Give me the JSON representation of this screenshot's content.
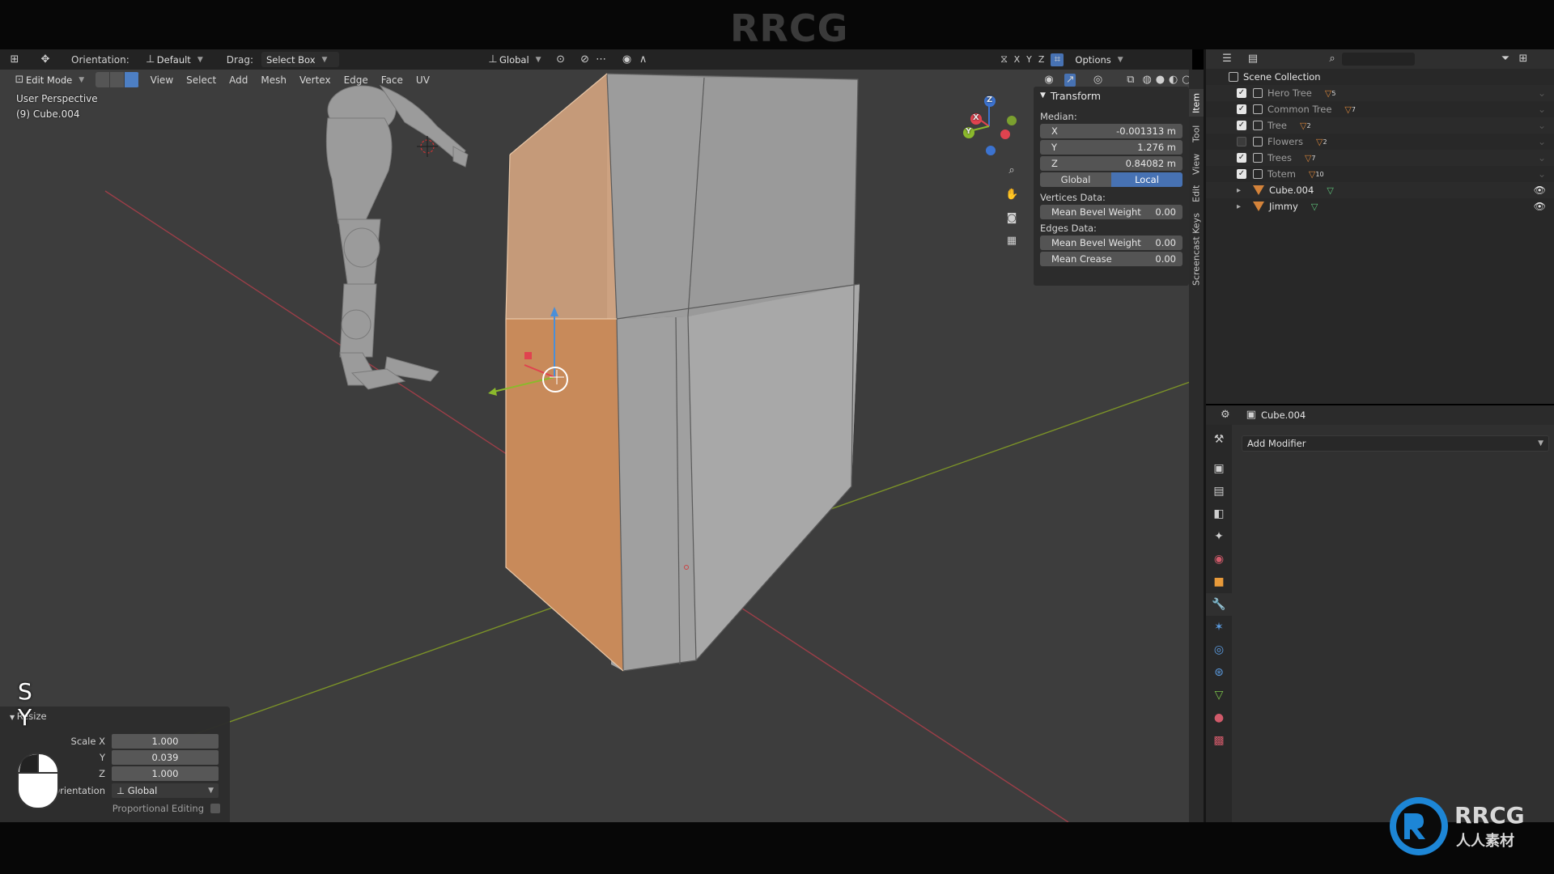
{
  "watermark": {
    "top": "RRCG",
    "logo_main": "RRCG",
    "logo_sub": "人人素材"
  },
  "header": {
    "orientation_label": "Orientation:",
    "orientation_value": "Default",
    "drag_label": "Drag:",
    "drag_value": "Select Box",
    "transform_orientation": "Global",
    "axes": [
      "X",
      "Y",
      "Z"
    ],
    "options_label": "Options"
  },
  "editbar": {
    "mode": "Edit Mode",
    "menus": [
      "View",
      "Select",
      "Add",
      "Mesh",
      "Vertex",
      "Edge",
      "Face",
      "UV"
    ]
  },
  "viewport": {
    "view_name": "User Perspective",
    "object_info": "(9) Cube.004",
    "gizmo_axes": {
      "x": "X",
      "y": "Y",
      "z": "Z"
    }
  },
  "npanel": {
    "title": "Transform",
    "median_label": "Median:",
    "median": [
      {
        "axis": "X",
        "value": "-0.001313 m"
      },
      {
        "axis": "Y",
        "value": "1.276 m"
      },
      {
        "axis": "Z",
        "value": "0.84082 m"
      }
    ],
    "space_options": [
      "Global",
      "Local"
    ],
    "space_active": "Local",
    "vertices_label": "Vertices Data:",
    "vertices_bevel": {
      "label": "Mean Bevel Weight",
      "value": "0.00"
    },
    "edges_label": "Edges Data:",
    "edges_bevel": {
      "label": "Mean Bevel Weight",
      "value": "0.00"
    },
    "edges_crease": {
      "label": "Mean Crease",
      "value": "0.00"
    },
    "tabs": [
      "Item",
      "Tool",
      "View",
      "Edit",
      "Screencast Keys"
    ],
    "active_tab": "Item"
  },
  "outliner": {
    "root": "Scene Collection",
    "items": [
      {
        "name": "Hero Tree",
        "checked": true,
        "kind": "collection",
        "badge": "5",
        "visible": false
      },
      {
        "name": "Common Tree",
        "checked": true,
        "kind": "collection",
        "badge": "7",
        "visible": false
      },
      {
        "name": "Tree",
        "checked": true,
        "kind": "collection",
        "badge": "2",
        "visible": false
      },
      {
        "name": "Flowers",
        "checked": false,
        "kind": "collection",
        "badge": "2",
        "visible": false
      },
      {
        "name": "Trees",
        "checked": true,
        "kind": "collection",
        "badge": "7",
        "visible": false
      },
      {
        "name": "Totem",
        "checked": true,
        "kind": "collection",
        "badge": "10",
        "visible": false
      },
      {
        "name": "Cube.004",
        "checked": null,
        "kind": "object",
        "badge": "",
        "visible": true
      },
      {
        "name": "Jimmy",
        "checked": null,
        "kind": "object",
        "badge": "",
        "visible": true
      }
    ]
  },
  "properties": {
    "object_name": "Cube.004",
    "add_modifier": "Add Modifier"
  },
  "last_operator": {
    "title": "Resize",
    "rows": [
      {
        "label": "Scale X",
        "value": "1.000"
      },
      {
        "label": "Y",
        "value": "0.039"
      },
      {
        "label": "Z",
        "value": "1.000"
      }
    ],
    "orientation_label": "Orientation",
    "orientation_value": "Global",
    "proportional_label": "Proportional Editing"
  },
  "keycast": {
    "first": "S",
    "second": "Y"
  },
  "colors": {
    "viewport_bg": "#3d3d3d",
    "selected_face": "#d4956a",
    "mesh_grey": "#a5a5a5",
    "accent_blue": "#4772b3",
    "axis_red": "#b83a4a",
    "axis_green": "#7f9b26"
  }
}
